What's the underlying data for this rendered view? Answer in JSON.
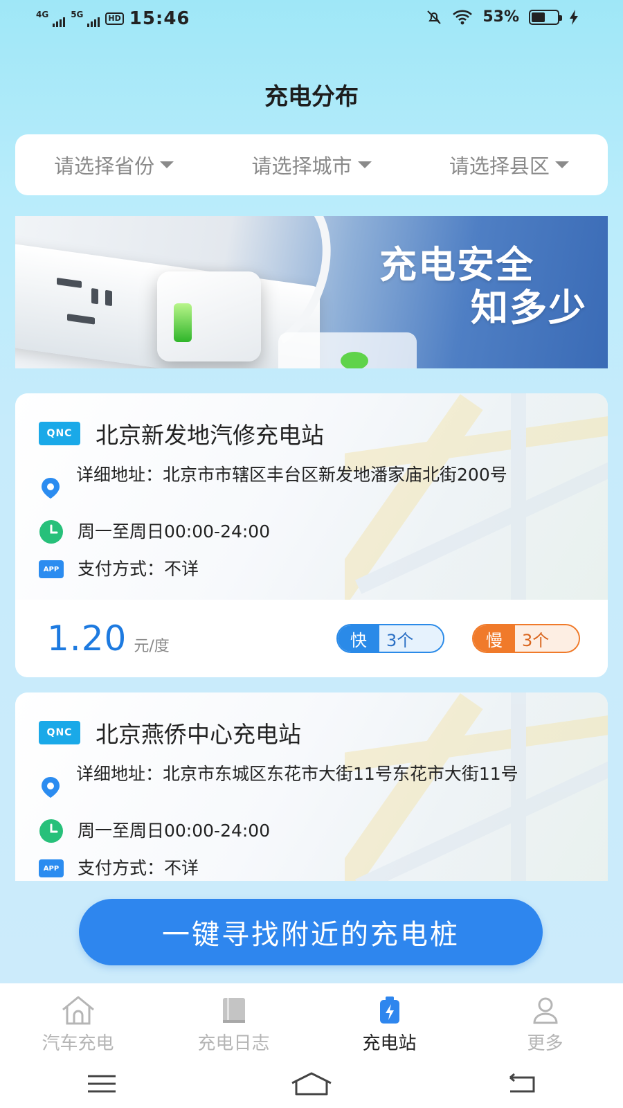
{
  "status_bar": {
    "network1": "4G",
    "network2": "5G",
    "hd_badge": "HD",
    "time": "15:46",
    "battery_percent": "53%",
    "battery_level": 0.53
  },
  "page_title": "充电分布",
  "selectors": {
    "province": "请选择省份",
    "city": "请选择城市",
    "district": "请选择县区"
  },
  "banner": {
    "line1": "充电安全",
    "line2": "知多少"
  },
  "stations": [
    {
      "badge": "QNC",
      "name": "北京新发地汽修充电站",
      "address": "详细地址：北京市市辖区丰台区新发地潘家庙北街200号",
      "hours": "周一至周日00:00-24:00",
      "payment": "支付方式：不详",
      "app_badge": "APP",
      "price": "1.20",
      "unit": "元/度",
      "fast_label": "快",
      "fast_count": "3个",
      "slow_label": "慢",
      "slow_count": "3个"
    },
    {
      "badge": "QNC",
      "name": "北京燕侨中心充电站",
      "address": "详细地址：北京市东城区东花市大街11号东花市大街11号",
      "hours": "周一至周日00:00-24:00",
      "payment": "支付方式：不详",
      "app_badge": "APP"
    }
  ],
  "cta_label": "一键寻找附近的充电桩",
  "bottom_nav": [
    {
      "label": "汽车充电",
      "icon": "house-icon",
      "active": false
    },
    {
      "label": "充电日志",
      "icon": "book-icon",
      "active": false
    },
    {
      "label": "充电站",
      "icon": "battery-charging-icon",
      "active": true
    },
    {
      "label": "更多",
      "icon": "person-icon",
      "active": false
    }
  ],
  "colors": {
    "accent": "#2e86ee",
    "fast": "#2a8ae8",
    "slow": "#f07a2a",
    "price": "#1d7ae0"
  }
}
